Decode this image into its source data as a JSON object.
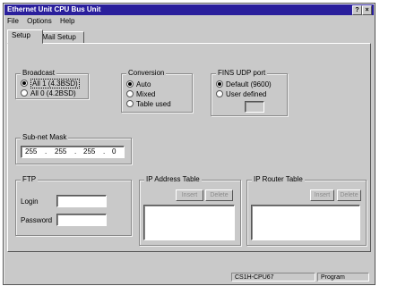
{
  "window": {
    "title": "Ethernet Unit CPU Bus Unit",
    "help_label": "?",
    "close_label": "×"
  },
  "menu": [
    "File",
    "Options",
    "Help"
  ],
  "tabs": [
    "Setup",
    "Mail Setup"
  ],
  "broadcast": {
    "label": "Broadcast",
    "options": [
      "All 1 (4.3BSD)",
      "All 0 (4.2BSD)"
    ],
    "selected": 0
  },
  "conversion": {
    "label": "Conversion",
    "options": [
      "Auto",
      "Mixed",
      "Table used"
    ],
    "selected": 0
  },
  "fins_udp": {
    "label": "FINS UDP port",
    "options": [
      "Default (9600)",
      "User defined"
    ],
    "selected": 0,
    "value": ""
  },
  "subnet": {
    "label": "Sub-net Mask",
    "octets": [
      "255",
      "255",
      "255",
      "0"
    ],
    "sep": "."
  },
  "ftp": {
    "label": "FTP",
    "login_label": "Login",
    "password_label": "Password",
    "login_value": "",
    "password_value": ""
  },
  "ip_address_table": {
    "label": "IP Address Table",
    "insert_label": "Insert",
    "delete_label": "Delete"
  },
  "ip_router_table": {
    "label": "IP Router Table",
    "insert_label": "Insert",
    "delete_label": "Delete"
  },
  "status": {
    "model": "CS1H-CPU67",
    "mode": "Program"
  }
}
